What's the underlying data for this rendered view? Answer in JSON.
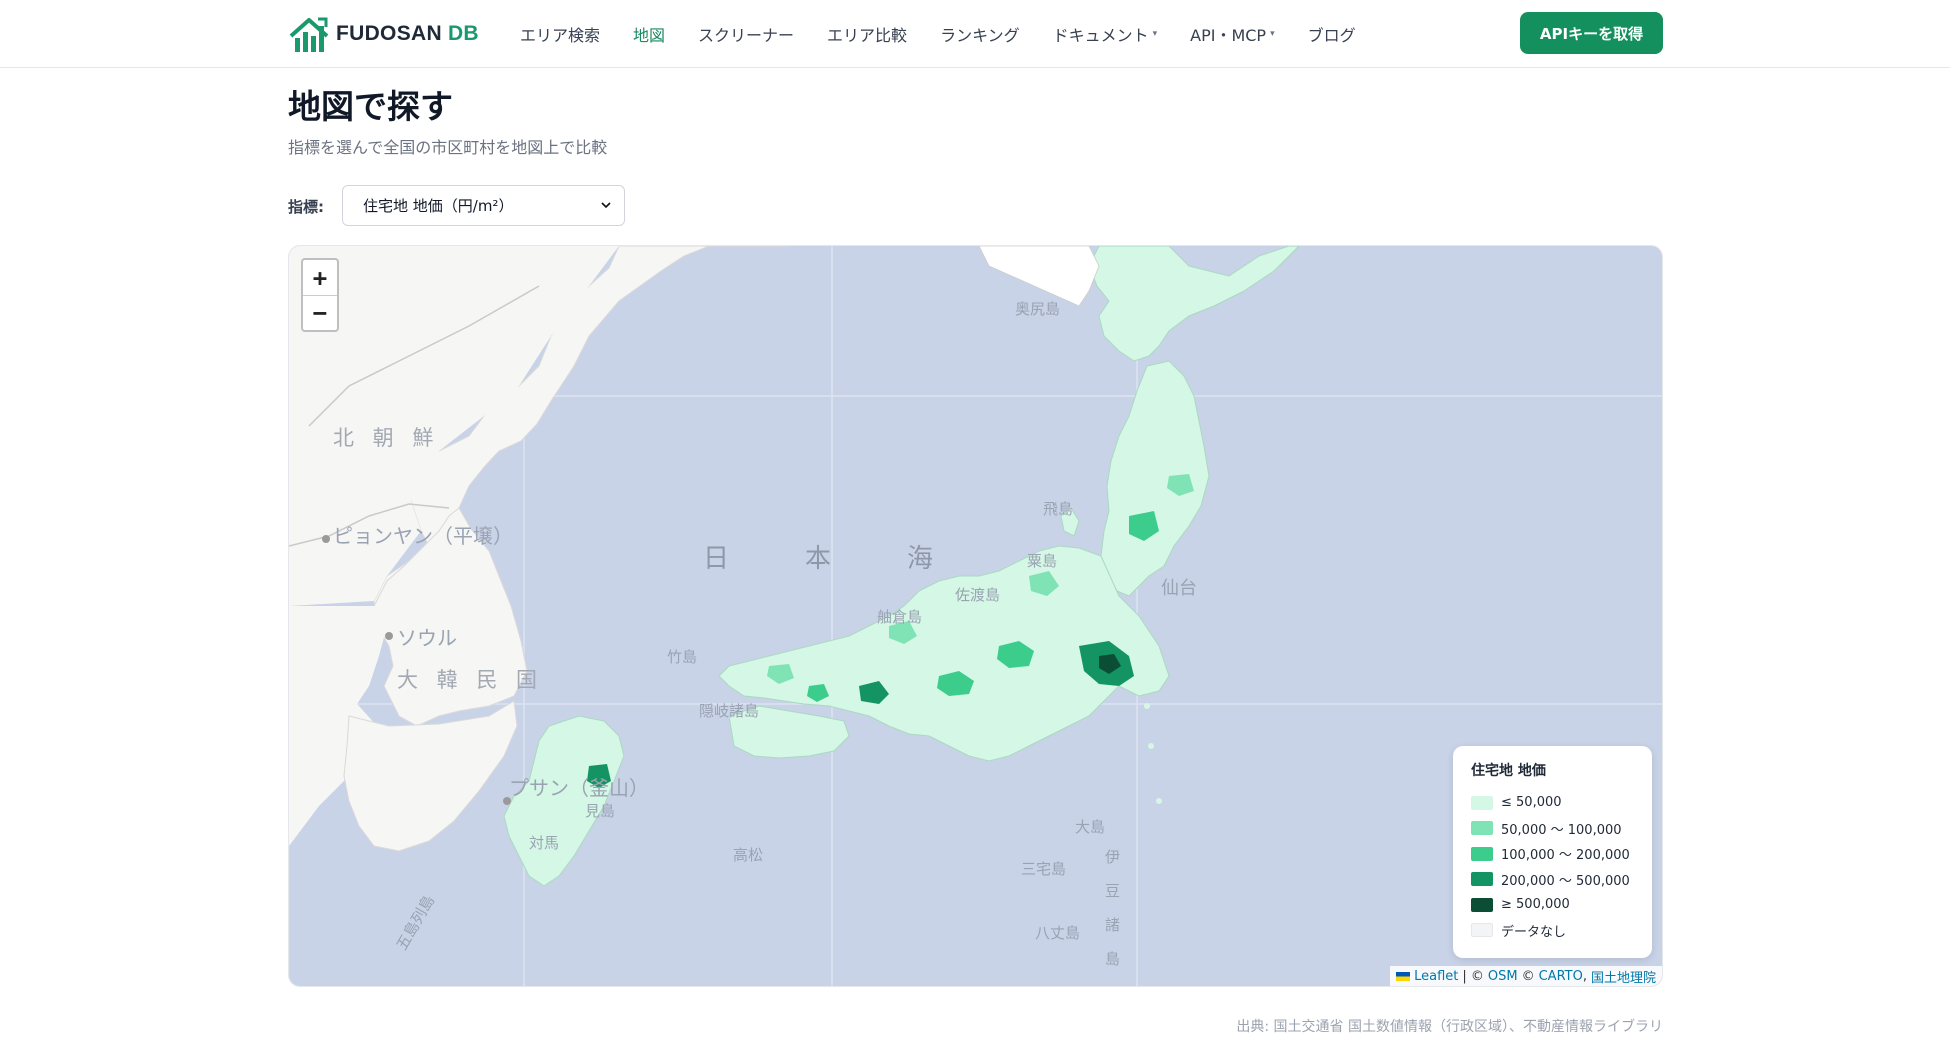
{
  "header": {
    "logo_text": "FUDOSAN",
    "logo_accent": "DB",
    "nav": [
      {
        "label": "エリア検索",
        "active": false,
        "dropdown": false
      },
      {
        "label": "地図",
        "active": true,
        "dropdown": false
      },
      {
        "label": "スクリーナー",
        "active": false,
        "dropdown": false
      },
      {
        "label": "エリア比較",
        "active": false,
        "dropdown": false
      },
      {
        "label": "ランキング",
        "active": false,
        "dropdown": false
      },
      {
        "label": "ドキュメント",
        "active": false,
        "dropdown": true
      },
      {
        "label": "API・MCP",
        "active": false,
        "dropdown": true
      },
      {
        "label": "ブログ",
        "active": false,
        "dropdown": false
      }
    ],
    "cta_label": "APIキーを取得"
  },
  "page": {
    "title": "地図で探す",
    "subtitle": "指標を選んで全国の市区町村を地図上で比較"
  },
  "metric": {
    "label": "指標:",
    "selected": "住宅地 地価（円/m²）"
  },
  "map": {
    "zoom_in": "+",
    "zoom_out": "−",
    "labels": {
      "north_korea": "北 朝 鮮",
      "pyongyang": "ピョンヤン（平壌）",
      "seoul": "ソウル",
      "south_korea": "大 韓 民 国",
      "busan": "プサン（釜山）",
      "sea_1": "日",
      "sea_2": "本",
      "sea_3": "海",
      "okushiri": "奥尻島",
      "tobishima": "飛島",
      "awashima": "粟島",
      "sado": "佐渡島",
      "hegura": "舳倉島",
      "takeshima": "竹島",
      "oki": "隠岐諸島",
      "sendai": "仙台",
      "oshima": "大島",
      "miyake": "三宅島",
      "hachijo": "八丈島",
      "izu_1": "伊",
      "izu_2": "豆",
      "izu_3": "諸",
      "izu_4": "島",
      "mishima": "見島",
      "tsushima": "対馬",
      "takamatsu": "高松",
      "goto": "五島列島"
    },
    "legend": {
      "title": "住宅地 地価",
      "items": [
        {
          "label": "≤ 50,000",
          "color": "#d4f7e6"
        },
        {
          "label": "50,000 〜 100,000",
          "color": "#7fe3b6"
        },
        {
          "label": "100,000 〜 200,000",
          "color": "#3ccd8c"
        },
        {
          "label": "200,000 〜 500,000",
          "color": "#139462"
        },
        {
          "label": "≥ 500,000",
          "color": "#0b4d35"
        },
        {
          "label": "データなし",
          "color": "#f3f4f6"
        }
      ]
    },
    "attribution": {
      "leaflet": "Leaflet",
      "sep1": "| ©",
      "osm": "OSM",
      "sep2": "©",
      "carto": "CARTO",
      "sep3": ",",
      "gsi": "国土地理院"
    }
  },
  "source": "出典: 国土交通省 国土数値情報（行政区域）、不動産情報ライブラリ"
}
